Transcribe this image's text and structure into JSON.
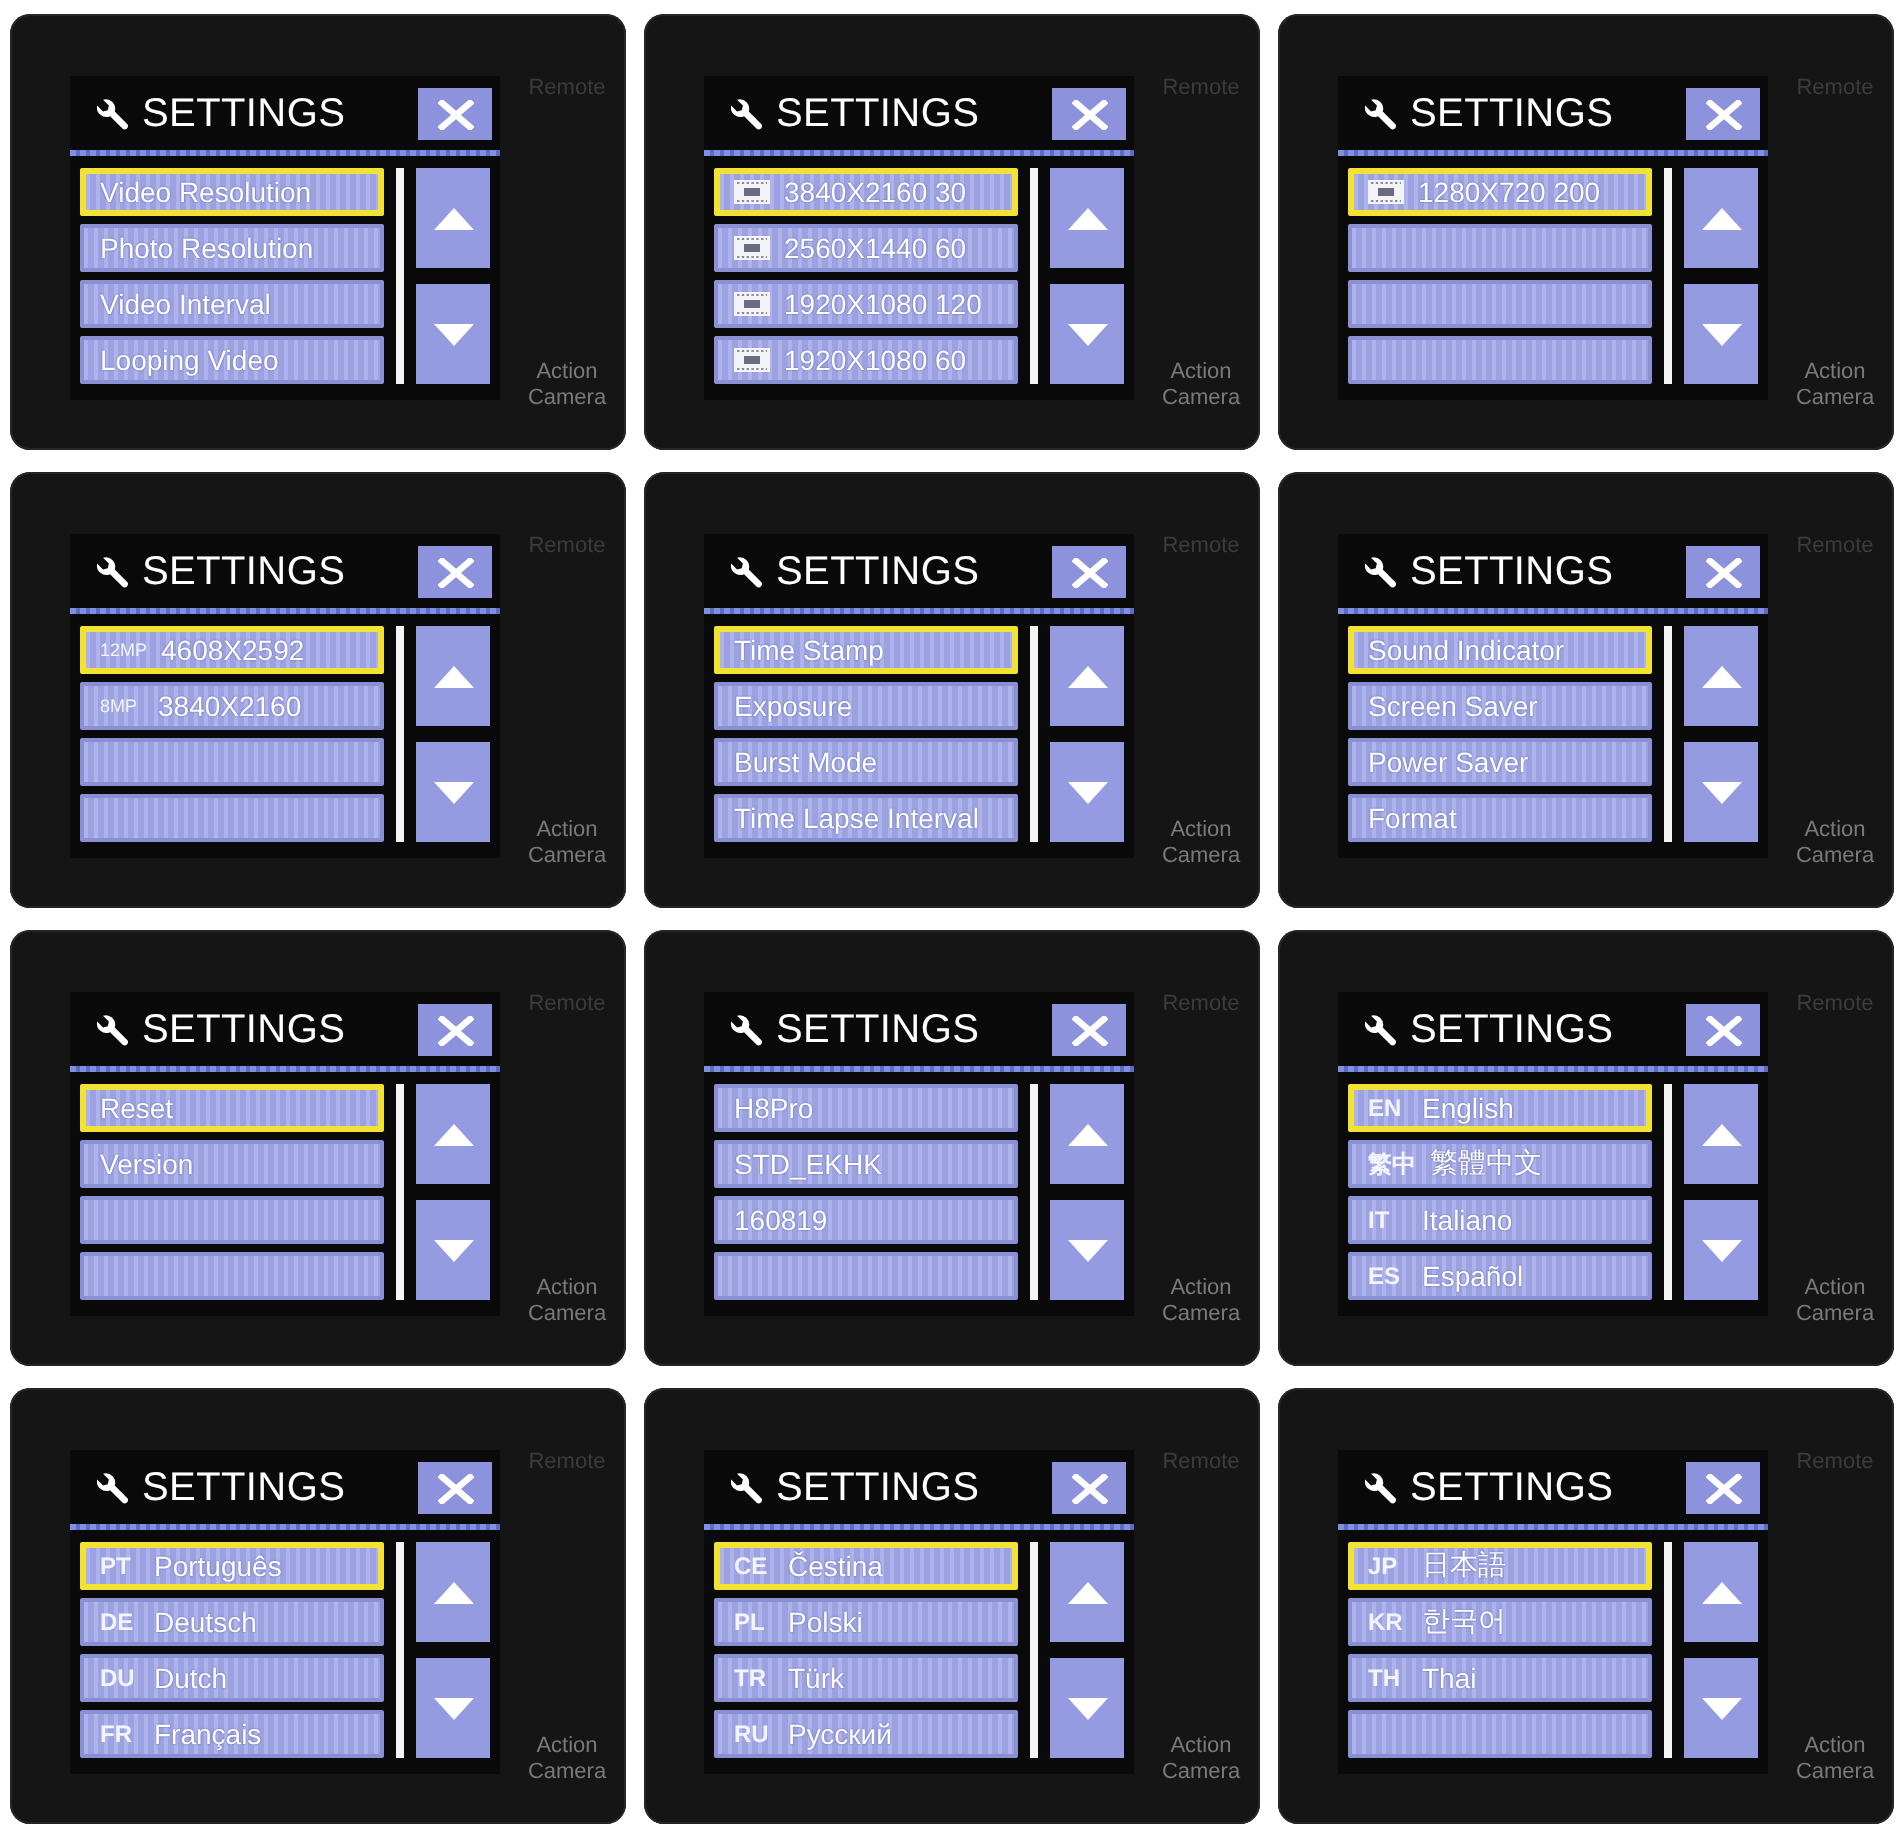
{
  "panels": [
    {
      "title": "SETTINGS",
      "top_label": "Remote",
      "bottom_label": "Action Camera",
      "items": [
        {
          "kind": "text",
          "label": "Video Resolution",
          "selected": true
        },
        {
          "kind": "text",
          "label": "Photo Resolution",
          "selected": false
        },
        {
          "kind": "text",
          "label": "Video Interval",
          "selected": false
        },
        {
          "kind": "text",
          "label": "Looping Video",
          "selected": false
        }
      ]
    },
    {
      "title": "SETTINGS",
      "top_label": "Remote",
      "bottom_label": "Action Camera",
      "items": [
        {
          "kind": "video_mode",
          "label": "3840X2160 30",
          "selected": true
        },
        {
          "kind": "video_mode",
          "label": "2560X1440 60",
          "selected": false
        },
        {
          "kind": "video_mode",
          "label": "1920X1080 120",
          "selected": false
        },
        {
          "kind": "video_mode",
          "label": "1920X1080 60",
          "selected": false
        }
      ]
    },
    {
      "title": "SETTINGS",
      "top_label": "Remote",
      "bottom_label": "Action Camera",
      "items": [
        {
          "kind": "video_mode",
          "label": "1280X720 200",
          "selected": true
        }
      ]
    },
    {
      "title": "SETTINGS",
      "top_label": "Remote",
      "bottom_label": "Action Camera",
      "items": [
        {
          "kind": "coded",
          "code": "12MP",
          "label": "4608X2592",
          "selected": true
        },
        {
          "kind": "coded",
          "code": "8MP",
          "label": "3840X2160",
          "selected": false
        }
      ]
    },
    {
      "title": "SETTINGS",
      "top_label": "Remote",
      "bottom_label": "Action Camera",
      "items": [
        {
          "kind": "text",
          "label": "Time Stamp",
          "selected": true
        },
        {
          "kind": "text",
          "label": "Exposure",
          "selected": false
        },
        {
          "kind": "text",
          "label": "Burst Mode",
          "selected": false
        },
        {
          "kind": "text",
          "label": "Time Lapse Interval",
          "selected": false
        }
      ]
    },
    {
      "title": "SETTINGS",
      "top_label": "Remote",
      "bottom_label": "Action Camera",
      "items": [
        {
          "kind": "text",
          "label": "Sound Indicator",
          "selected": true
        },
        {
          "kind": "text",
          "label": "Screen Saver",
          "selected": false
        },
        {
          "kind": "text",
          "label": "Power Saver",
          "selected": false
        },
        {
          "kind": "text",
          "label": "Format",
          "selected": false
        }
      ]
    },
    {
      "title": "SETTINGS",
      "top_label": "Remote",
      "bottom_label": "Action Camera",
      "items": [
        {
          "kind": "text",
          "label": "Reset",
          "selected": true
        },
        {
          "kind": "text",
          "label": "Version",
          "selected": false
        }
      ]
    },
    {
      "title": "SETTINGS",
      "top_label": "Remote",
      "bottom_label": "Action Camera",
      "items": [
        {
          "kind": "text",
          "label": "H8Pro",
          "selected": false
        },
        {
          "kind": "text",
          "label": "STD_EKHK",
          "selected": false
        },
        {
          "kind": "text",
          "label": "160819",
          "selected": false
        }
      ]
    },
    {
      "title": "SETTINGS",
      "top_label": "Remote",
      "bottom_label": "Action Camera",
      "items": [
        {
          "kind": "language",
          "code": "EN",
          "label": "English",
          "selected": true
        },
        {
          "kind": "language",
          "code": "繁中",
          "label": "繁體中文",
          "selected": false
        },
        {
          "kind": "language",
          "code": "IT",
          "label": "Italiano",
          "selected": false
        },
        {
          "kind": "language",
          "code": "ES",
          "label": "Español",
          "selected": false
        }
      ]
    },
    {
      "title": "SETTINGS",
      "top_label": "Remote",
      "bottom_label": "Action Camera",
      "items": [
        {
          "kind": "language",
          "code": "PT",
          "label": "Português",
          "selected": true
        },
        {
          "kind": "language",
          "code": "DE",
          "label": "Deutsch",
          "selected": false
        },
        {
          "kind": "language",
          "code": "DU",
          "label": "Dutch",
          "selected": false
        },
        {
          "kind": "language",
          "code": "FR",
          "label": "Français",
          "selected": false
        }
      ]
    },
    {
      "title": "SETTINGS",
      "top_label": "Remote",
      "bottom_label": "Action Camera",
      "items": [
        {
          "kind": "language",
          "code": "CE",
          "label": "Čestina",
          "selected": true
        },
        {
          "kind": "language",
          "code": "PL",
          "label": "Polski",
          "selected": false
        },
        {
          "kind": "language",
          "code": "TR",
          "label": "Türk",
          "selected": false
        },
        {
          "kind": "language",
          "code": "RU",
          "label": "Русский",
          "selected": false
        }
      ]
    },
    {
      "title": "SETTINGS",
      "top_label": "Remote",
      "bottom_label": "Action Camera",
      "items": [
        {
          "kind": "language",
          "code": "JP",
          "label": "日本語",
          "selected": true
        },
        {
          "kind": "language",
          "code": "KR",
          "label": "한국어",
          "selected": false
        },
        {
          "kind": "language",
          "code": "TH",
          "label": "Thai",
          "selected": false
        }
      ]
    }
  ]
}
